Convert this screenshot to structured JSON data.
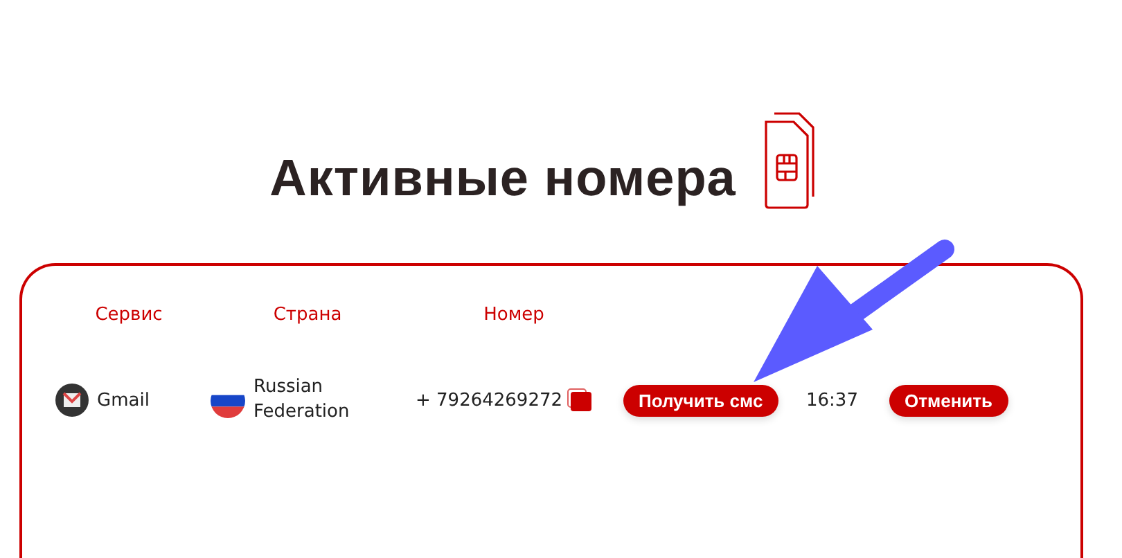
{
  "title": "Активные номера",
  "table": {
    "columns": [
      "Сервис",
      "Страна",
      "Номер"
    ],
    "rows": [
      {
        "service": "Gmail",
        "country": "Russian Federation",
        "number": "+ 79264269272",
        "get_sms": "Получить смс",
        "time": "16:37",
        "cancel": "Отменить"
      }
    ]
  }
}
